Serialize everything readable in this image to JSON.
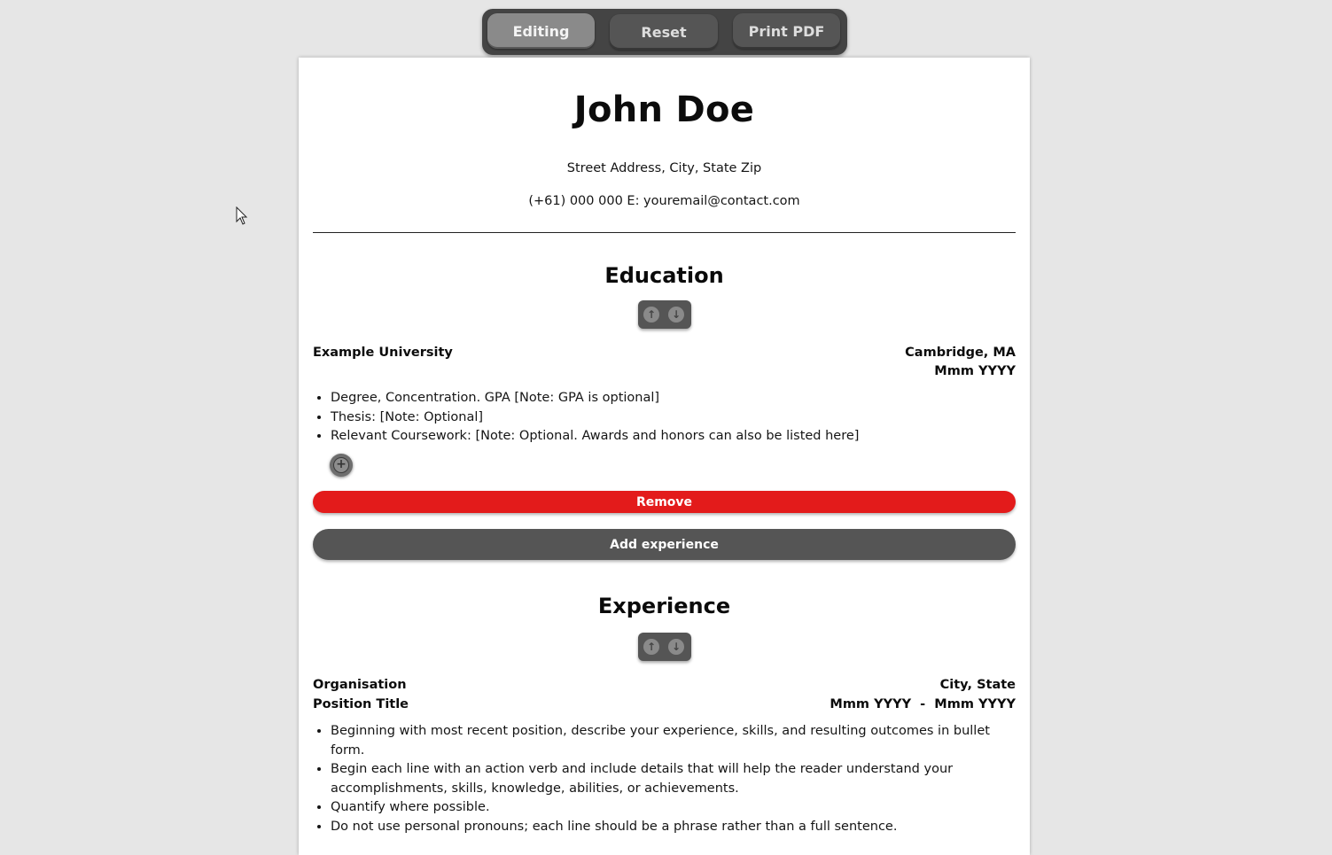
{
  "toolbar": {
    "editing_label": "Editing",
    "reset_label": "Reset",
    "print_label": "Print PDF"
  },
  "header": {
    "name": "John Doe",
    "address": "Street Address, City, State Zip",
    "contact": "(+61) 000 000 E: youremail@contact.com"
  },
  "education": {
    "title": "Education",
    "institution": "Example University",
    "location": "Cambridge, MA",
    "date": "Mmm YYYY",
    "bullets": [
      "Degree, Concentration. GPA [Note: GPA is optional]",
      "Thesis: [Note: Optional]",
      "Relevant Coursework: [Note: Optional. Awards and honors can also be listed here]"
    ],
    "remove_label": "Remove",
    "add_experience_label": "Add experience"
  },
  "experience": {
    "title": "Experience",
    "organisation": "Organisation",
    "location": "City, State",
    "position": "Position Title",
    "dates": "Mmm YYYY  -  Mmm YYYY",
    "bullets": [
      "Beginning with most recent position, describe your experience, skills, and resulting outcomes in bullet form.",
      "Begin each line with an action verb and include details that will help the reader understand your accomplishments, skills, knowledge, abilities, or achievements.",
      "Quantify where possible.",
      "Do not use personal pronouns; each line should be a phrase rather than a full sentence."
    ]
  },
  "icons": {
    "move_up": "arrow-up-icon",
    "move_down": "arrow-down-icon",
    "add": "plus-icon",
    "cursor": "mouse-pointer-icon"
  },
  "colors": {
    "background": "#e6e6e6",
    "toolbar": "#444444",
    "remove": "#e31b1b",
    "add_experience": "#555555"
  }
}
